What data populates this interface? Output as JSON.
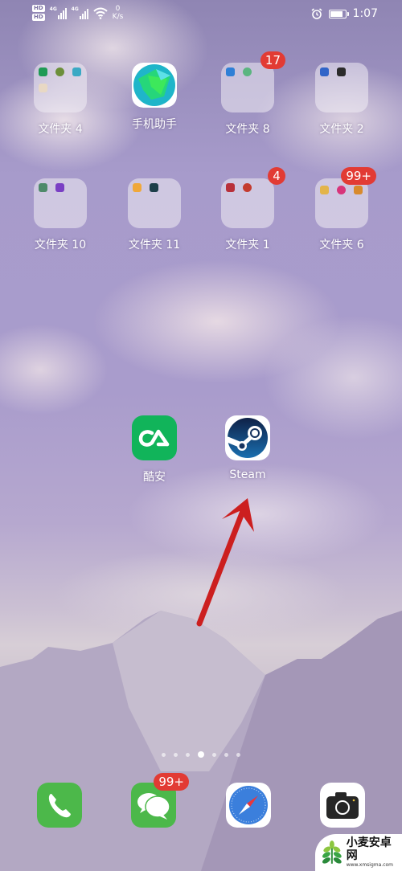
{
  "status_bar": {
    "hd_labels": [
      "HD",
      "HD"
    ],
    "network_labels": [
      "4G",
      "4G"
    ],
    "speed_value": "0",
    "speed_unit": "K/s",
    "battery_level": 0.75,
    "time": "1:07",
    "icons": [
      "alarm-icon",
      "battery-icon",
      "wifi-icon",
      "signal-icon"
    ]
  },
  "home": {
    "folders": [
      {
        "name": "文件夹 4",
        "badge": null,
        "mini_icon_colors": [
          "#1f9a55",
          "#6c8f3a",
          "#3aa9c4",
          "#e8d8c4"
        ]
      },
      {
        "name": "文件夹 8",
        "badge": "17",
        "mini_icon_colors": [
          "#2f7fd6",
          "#5bb580"
        ]
      },
      {
        "name": "文件夹 2",
        "badge": null,
        "mini_icon_colors": [
          "#3064c8",
          "#2b2b2b"
        ]
      },
      {
        "name": "文件夹 10",
        "badge": null,
        "mini_icon_colors": [
          "#4e8a6a",
          "#7a3fc4"
        ]
      },
      {
        "name": "文件夹 11",
        "badge": null,
        "mini_icon_colors": [
          "#f0a83a",
          "#1d3f4a"
        ]
      },
      {
        "name": "文件夹 1",
        "badge": "4",
        "mini_icon_colors": [
          "#b8303a",
          "#c43b2e"
        ]
      },
      {
        "name": "文件夹 6",
        "badge": "99+",
        "mini_icon_colors": [
          "#e3b44a",
          "#d8347a",
          "#d88a2c"
        ]
      }
    ],
    "apps": [
      {
        "name": "手机助手",
        "icon": "phone-assistant-icon"
      },
      {
        "name": "酷安",
        "icon": "coolapk-icon"
      },
      {
        "name": "Steam",
        "icon": "steam-icon"
      }
    ]
  },
  "page_indicator": {
    "pages": 7,
    "active_index": 3
  },
  "dock": [
    {
      "name": "phone",
      "icon": "phone-icon",
      "badge": null
    },
    {
      "name": "messages",
      "icon": "messages-icon",
      "badge": "99+"
    },
    {
      "name": "browser",
      "icon": "compass-icon",
      "badge": null
    },
    {
      "name": "camera",
      "icon": "camera-icon",
      "badge": null
    }
  ],
  "annotation": {
    "type": "arrow",
    "color": "#cc1f1f",
    "points_to": "Steam"
  },
  "watermark": {
    "title": "小麦安卓网",
    "url": "www.xmsigma.com"
  }
}
